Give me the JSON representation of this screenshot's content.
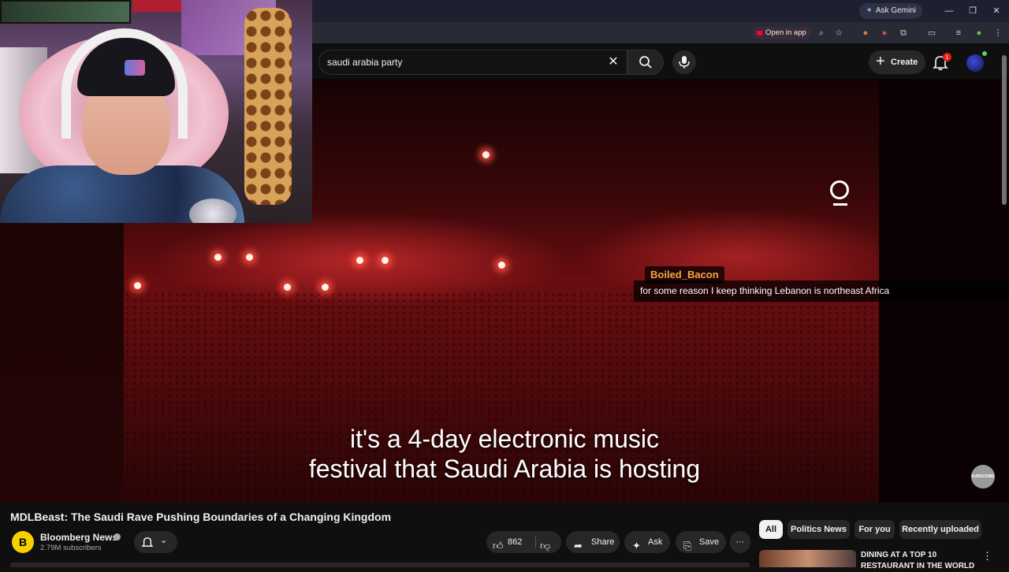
{
  "browser": {
    "ask_gemini": "Ask Gemini",
    "open_in_app": "Open in app"
  },
  "search": {
    "query": "saudi arabia party"
  },
  "header": {
    "create_label": "Create",
    "notification_count": "1"
  },
  "video": {
    "caption_line1": "it's a 4-day electronic music",
    "caption_line2": "festival that Saudi Arabia is hosting",
    "watermark": "SUBSCRIBE"
  },
  "chat": {
    "username": "Boiled_Bacon",
    "message": "for some reason I keep thinking Lebanon is northeast Africa",
    "username_color": "#f5a742"
  },
  "watch": {
    "title": "MDLBeast: The Saudi Rave Pushing Boundaries of a Changing Kingdom",
    "channel": {
      "avatar_letter": "B",
      "name": "Bloomberg News",
      "subscribers": "2.79M subscribers"
    },
    "actions": {
      "like_count": "862",
      "share": "Share",
      "ask": "Ask",
      "save": "Save"
    }
  },
  "chips": [
    {
      "label": "All",
      "active": true
    },
    {
      "label": "Politics News"
    },
    {
      "label": "For you"
    },
    {
      "label": "Recently uploaded"
    }
  ],
  "recommendation": {
    "title": "DINING AT A TOP 10 RESTAURANT IN THE WORLD"
  },
  "colors": {
    "accent": "#ff0033",
    "background": "#0f0f0f"
  }
}
